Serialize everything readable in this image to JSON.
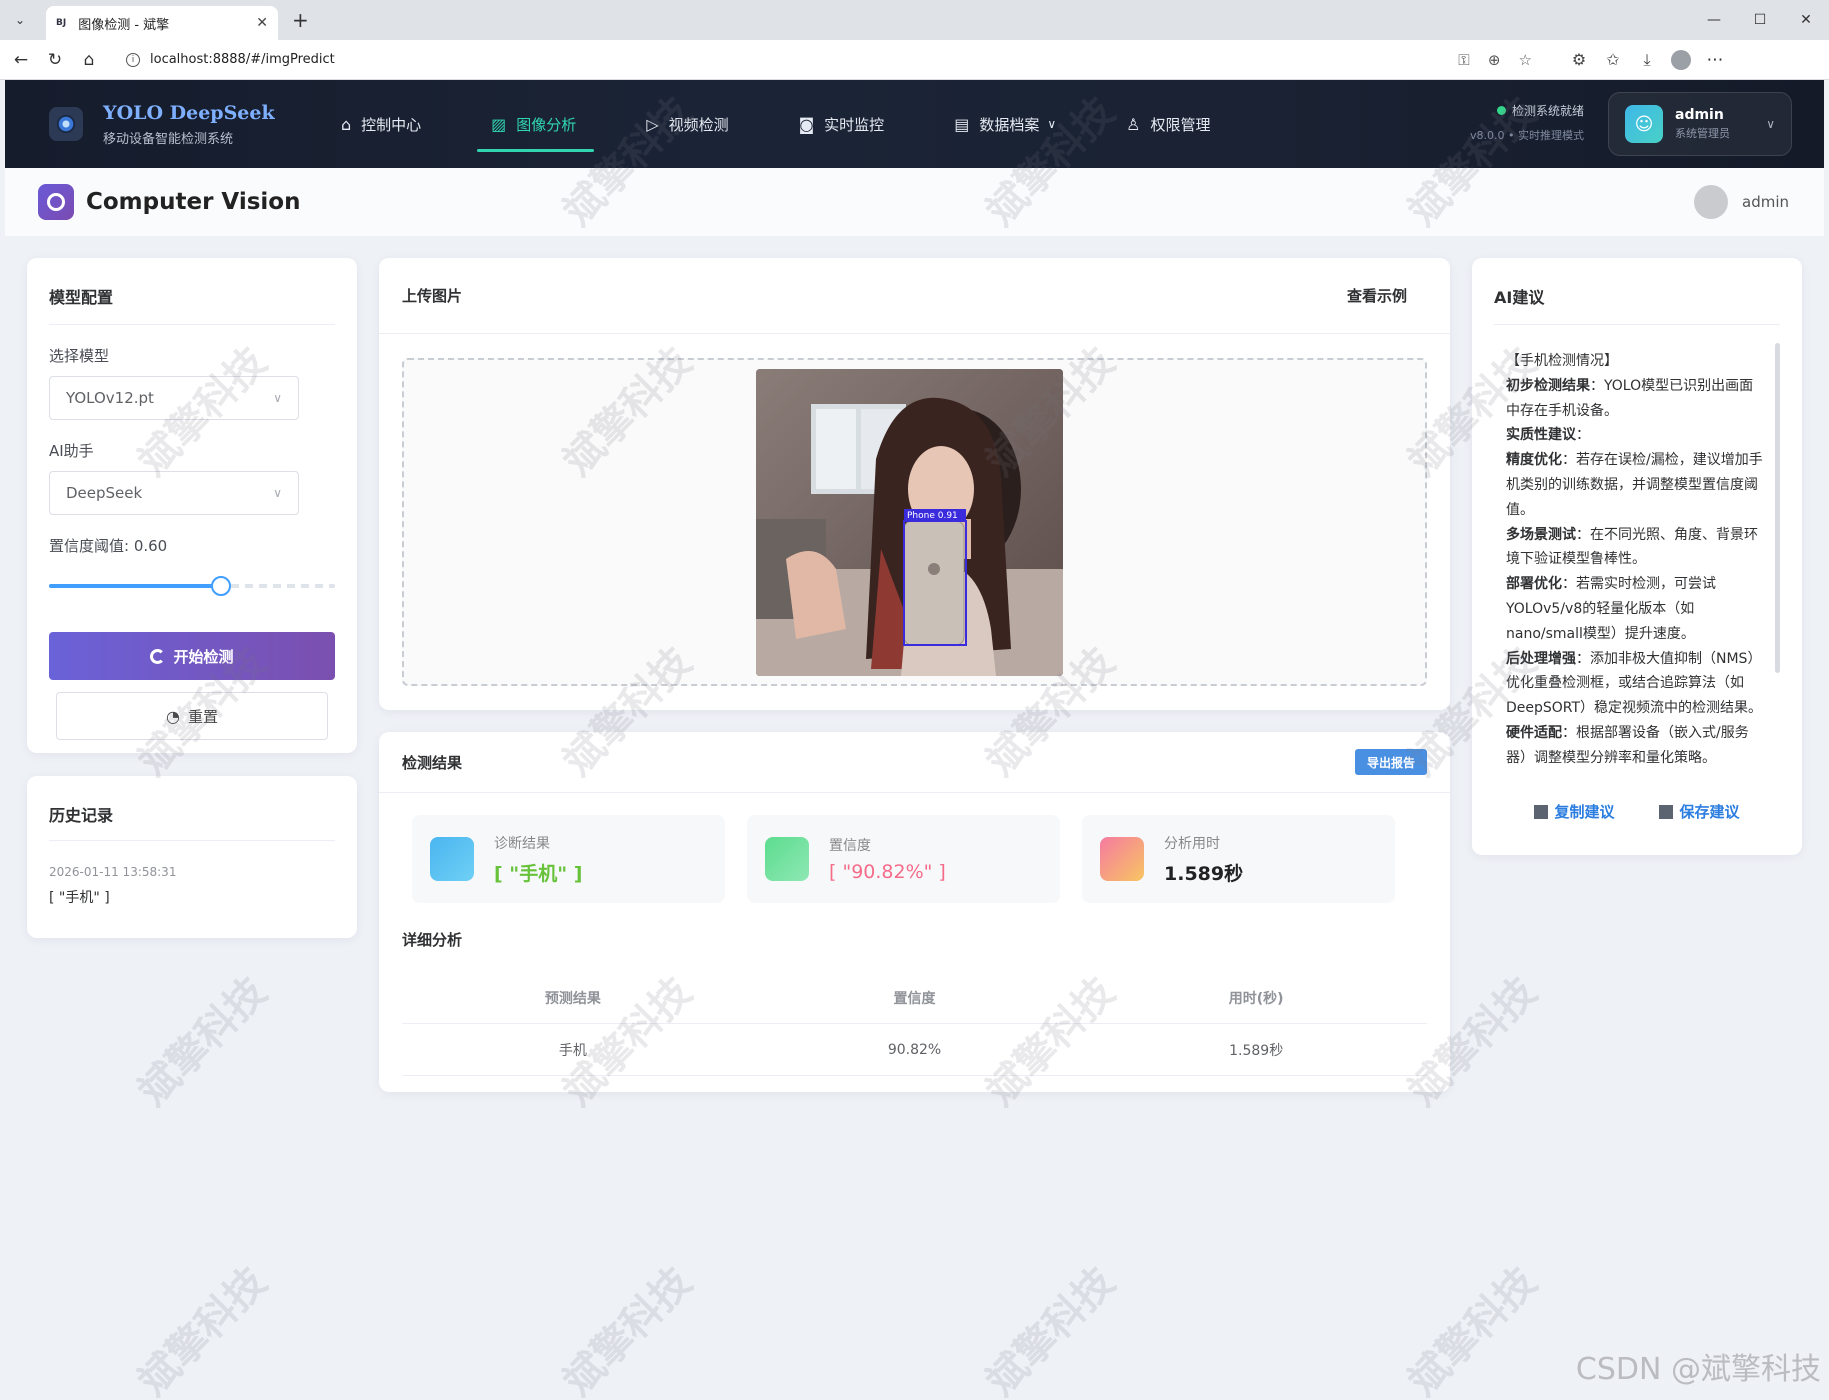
{
  "browser": {
    "tab_title": "图像检测 - 斌擎",
    "tab_favicon": "BJ",
    "url": "localhost:8888/#/imgPredict"
  },
  "app_header": {
    "brand_name": "YOLO DeepSeek",
    "brand_sub": "移动设备智能检测系统",
    "nav": [
      {
        "label": "控制中心",
        "icon": "home-icon"
      },
      {
        "label": "图像分析",
        "icon": "image-icon",
        "active": true
      },
      {
        "label": "视频检测",
        "icon": "play-circle-icon"
      },
      {
        "label": "实时监控",
        "icon": "camera-icon"
      },
      {
        "label": "数据档案",
        "icon": "document-icon",
        "dropdown": true
      },
      {
        "label": "权限管理",
        "icon": "user-icon"
      }
    ],
    "status_text": "检测系统就绪",
    "status_sub": "v8.0.0 • 实时推理模式",
    "user_name": "admin",
    "user_role": "系统管理员"
  },
  "subheader": {
    "title": "Computer Vision",
    "user": "admin"
  },
  "model_config": {
    "title": "模型配置",
    "model_label": "选择模型",
    "model_value": "YOLOv12.pt",
    "ai_label": "AI助手",
    "ai_value": "DeepSeek",
    "threshold_label": "置信度阈值: 0.60",
    "threshold_value": 0.6,
    "start_button": "开始检测",
    "reset_button": "重置"
  },
  "history": {
    "title": "历史记录",
    "items": [
      {
        "time": "2026-01-11 13:58:31",
        "value": "[ \"手机\" ]"
      }
    ]
  },
  "upload": {
    "title": "上传图片",
    "example_link": "查看示例",
    "detection_label": "Phone 0.91"
  },
  "results": {
    "title": "检测结果",
    "export_button": "导出报告",
    "stats": [
      {
        "label": "诊断结果",
        "value": "[ \"手机\" ]",
        "color": "#67c23a"
      },
      {
        "label": "置信度",
        "value": "[ \"90.82%\" ]",
        "color": "#f56c8a"
      },
      {
        "label": "分析用时",
        "value": "1.589秒",
        "color": "#222222"
      }
    ],
    "detail_title": "详细分析",
    "table_headers": [
      "预测结果",
      "置信度",
      "用时(秒)"
    ],
    "table_rows": [
      [
        "手机",
        "90.82%",
        "1.589秒"
      ]
    ]
  },
  "ai_advice": {
    "title": "AI建议",
    "heading": "【手机检测情况】",
    "paragraphs": [
      {
        "bold": "初步检测结果",
        "text": "：YOLO模型已识别出画面中存在手机设备。"
      },
      {
        "bold": "实质性建议",
        "text": "："
      },
      {
        "bold": "精度优化",
        "text": "：若存在误检/漏检，建议增加手机类别的训练数据，并调整模型置信度阈值。"
      },
      {
        "bold": "多场景测试",
        "text": "：在不同光照、角度、背景环境下验证模型鲁棒性。"
      },
      {
        "bold": "部署优化",
        "text": "：若需实时检测，可尝试YOLOv5/v8的轻量化版本（如nano/small模型）提升速度。"
      },
      {
        "bold": "后处理增强",
        "text": "：添加非极大值抑制（NMS）优化重叠检测框，或结合追踪算法（如DeepSORT）稳定视频流中的检测结果。"
      },
      {
        "bold": "硬件适配",
        "text": "：根据部署设备（嵌入式/服务器）调整模型分辨率和量化策略。"
      }
    ],
    "copy_button": "复制建议",
    "save_button": "保存建议"
  },
  "watermark": "斌擎科技",
  "csdn_mark": "CSDN @斌擎科技"
}
